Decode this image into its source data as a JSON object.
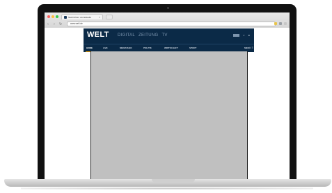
{
  "browser": {
    "tab_title": "Nachrichten und aktuelle",
    "tab_close": "×",
    "address": "www.welt.de",
    "nav": {
      "back": "‹",
      "forward": "›",
      "reload": "↻"
    }
  },
  "welt": {
    "logo": "WELT",
    "tabs": [
      "DIGITAL",
      "ZEITUNG",
      "TV"
    ],
    "subnav": [
      "HOME",
      "LIVE",
      "MEDIATHEK",
      "POLITIK",
      "WIRTSCHAFT",
      "SPORT"
    ],
    "active_subnav": "HOME",
    "menu_label": "MENÜ",
    "tool_icons": [
      "search-icon",
      "user-icon"
    ]
  },
  "colors": {
    "header_bg": "#0b2a47",
    "accent": "#f2a100",
    "placeholder": "#c0c0c0"
  }
}
